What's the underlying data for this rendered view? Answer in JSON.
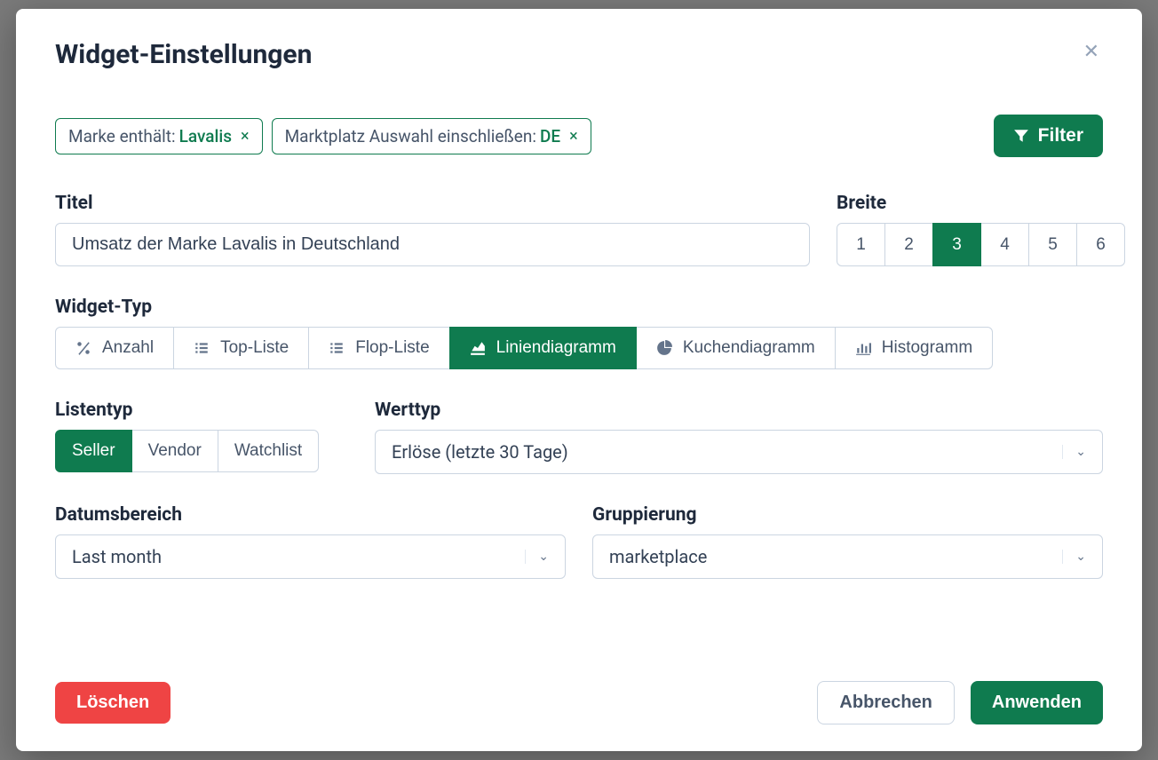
{
  "modal": {
    "title": "Widget-Einstellungen"
  },
  "filters": {
    "chips": [
      {
        "label": "Marke enthält: ",
        "value": "Lavalis"
      },
      {
        "label": "Marktplatz Auswahl einschließen: ",
        "value": "DE"
      }
    ],
    "button_label": "Filter"
  },
  "titel": {
    "label": "Titel",
    "value": "Umsatz der Marke Lavalis in Deutschland"
  },
  "breite": {
    "label": "Breite",
    "options": [
      "1",
      "2",
      "3",
      "4",
      "5",
      "6"
    ],
    "selected": "3"
  },
  "widget_typ": {
    "label": "Widget-Typ",
    "options": [
      {
        "id": "anzahl",
        "label": "Anzahl",
        "icon": "percent"
      },
      {
        "id": "topliste",
        "label": "Top-Liste",
        "icon": "list"
      },
      {
        "id": "flopliste",
        "label": "Flop-Liste",
        "icon": "list"
      },
      {
        "id": "liniendiagramm",
        "label": "Liniendiagramm",
        "icon": "line"
      },
      {
        "id": "kuchendiagramm",
        "label": "Kuchendiagramm",
        "icon": "pie"
      },
      {
        "id": "histogramm",
        "label": "Histogramm",
        "icon": "bar"
      }
    ],
    "selected": "liniendiagramm"
  },
  "listentyp": {
    "label": "Listentyp",
    "options": [
      "Seller",
      "Vendor",
      "Watchlist"
    ],
    "selected": "Seller"
  },
  "werttyp": {
    "label": "Werttyp",
    "value": "Erlöse (letzte 30 Tage)"
  },
  "datumsbereich": {
    "label": "Datumsbereich",
    "value": "Last month"
  },
  "gruppierung": {
    "label": "Gruppierung",
    "value": "marketplace"
  },
  "footer": {
    "delete": "Löschen",
    "cancel": "Abbrechen",
    "apply": "Anwenden"
  }
}
